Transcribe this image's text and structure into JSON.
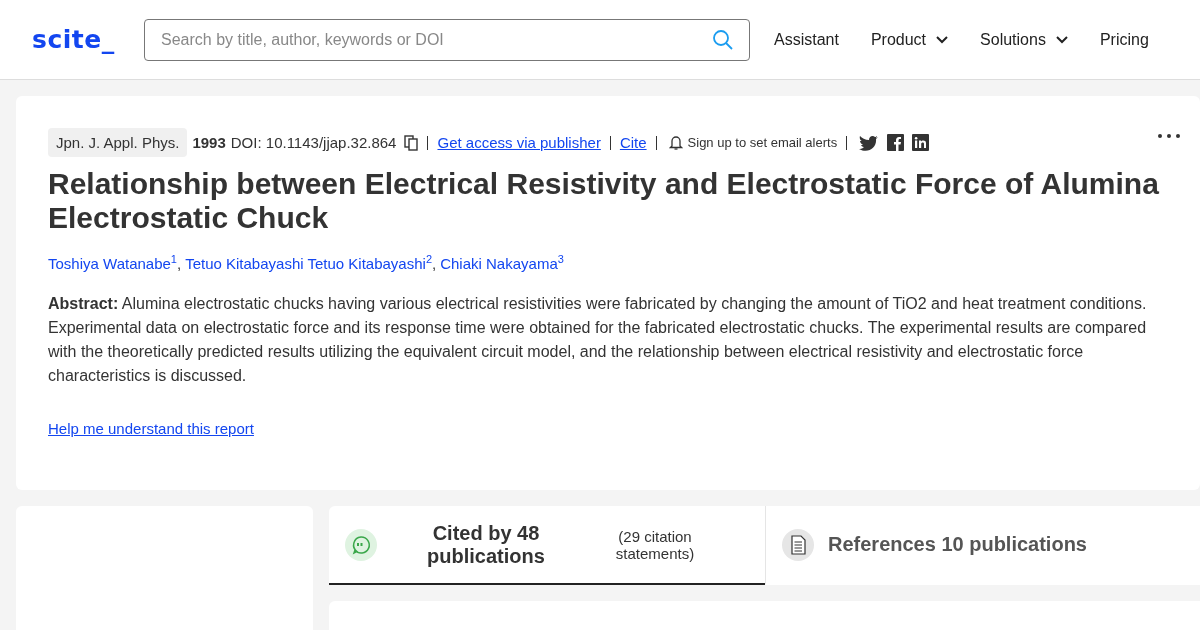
{
  "header": {
    "logo": "scite_",
    "search": {
      "placeholder": "Search by title, author, keywords or DOI"
    },
    "nav": [
      {
        "label": "Assistant",
        "dropdown": false
      },
      {
        "label": "Product",
        "dropdown": true
      },
      {
        "label": "Solutions",
        "dropdown": true
      },
      {
        "label": "Pricing",
        "dropdown": false
      }
    ]
  },
  "paper": {
    "journal": "Jpn. J. Appl. Phys.",
    "year": "1993",
    "doi": "DOI: 10.1143/jjap.32.864",
    "links": [
      {
        "label": "Get access via publisher"
      },
      {
        "label": "Cite"
      }
    ],
    "alerts": "Sign up to set email alerts",
    "title": "Relationship between Electrical Resistivity and Electrostatic Force of Alumina Electrostatic Chuck",
    "authors": [
      {
        "name": "Toshiya Watanabe",
        "mark": "1",
        "separator": ","
      },
      {
        "name": "Tetuo Kitabayashi Tetuo Kitabayashi",
        "mark": "2",
        "separator": ","
      },
      {
        "name": "Chiaki Nakayama",
        "mark": "3"
      }
    ],
    "abstract": "**Abstract:** Alumina electrostatic chucks having various electrical resistivities were fabricated by changing the amount of TiO2 and heat treatment conditions. Experimental data on electrostatic force and its response time were obtained for the fabricated electrostatic chucks. The experimental results are compared with the theoretically predicted results utilizing the equivalent circuit model, and the relationship between electrical resistivity and electrostatic force characteristics is discussed.",
    "help_link": "Help me understand this report"
  },
  "tabs": [
    {
      "kind": "citations",
      "title": "Cited by 48 publications",
      "subtitle": "(29 citation statements)",
      "selected": true
    },
    {
      "kind": "references",
      "title": "References 10 publications",
      "selected": false
    }
  ]
}
